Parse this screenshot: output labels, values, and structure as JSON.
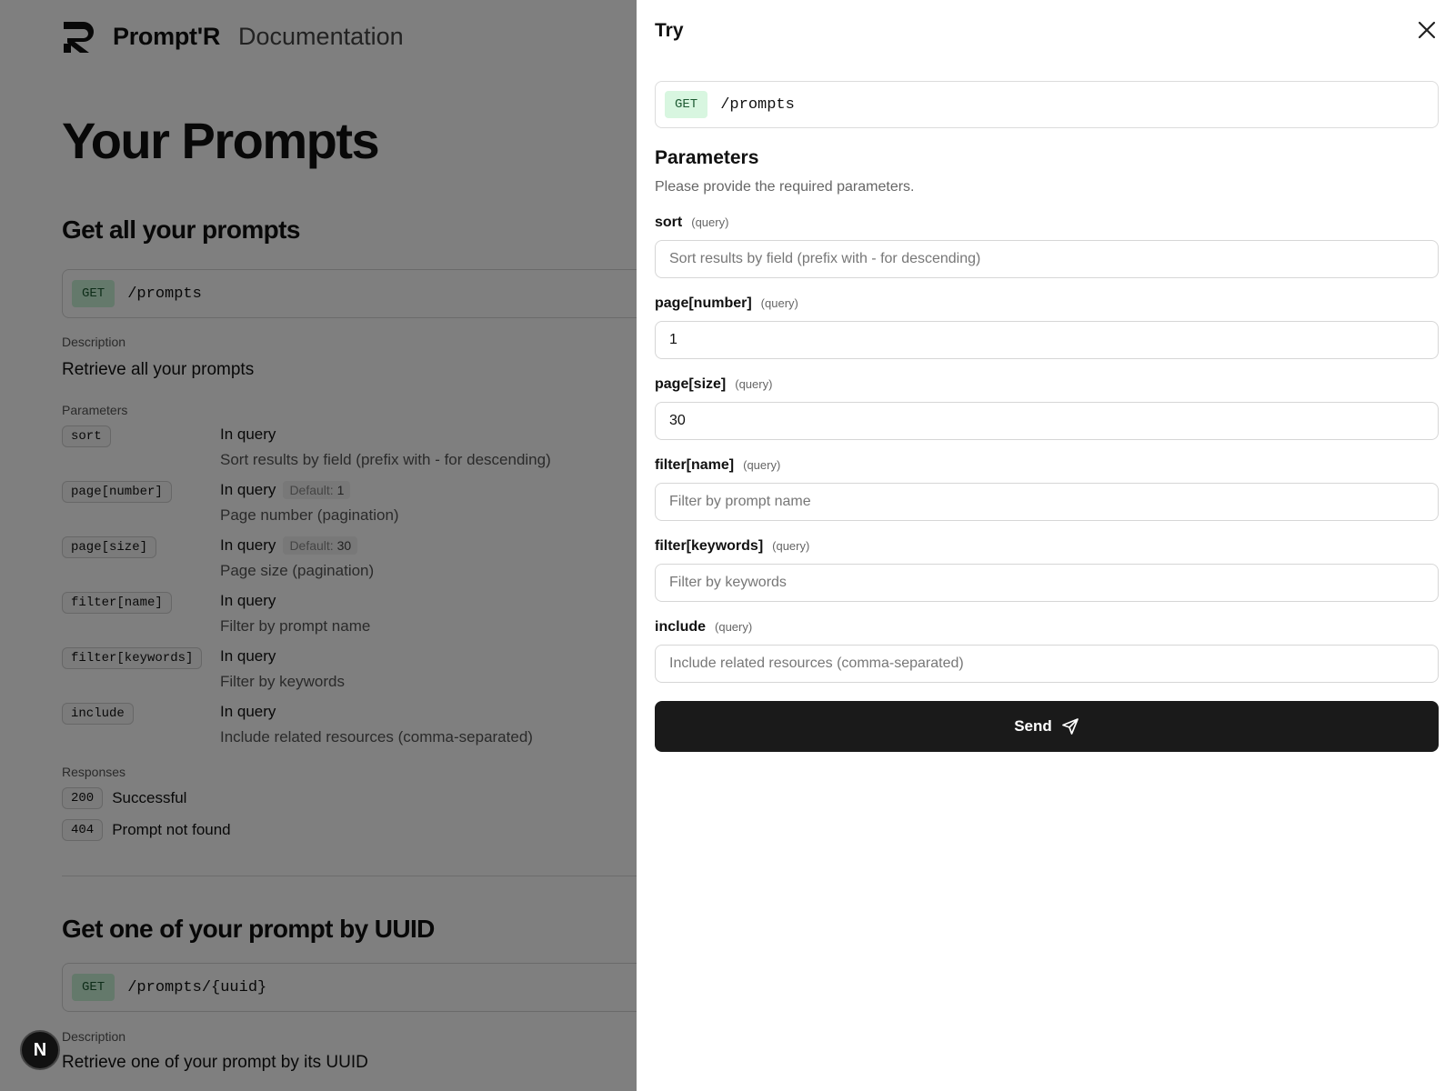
{
  "header": {
    "brand": "Prompt'R",
    "subtitle": "Documentation"
  },
  "page": {
    "title": "Your Prompts"
  },
  "section1": {
    "title": "Get all your prompts",
    "method": "GET",
    "path": "/prompts",
    "description_label": "Description",
    "description": "Retrieve all your prompts",
    "parameters_label": "Parameters",
    "params": [
      {
        "name": "sort",
        "in": "In query",
        "default_label": "",
        "default_value": "",
        "description": "Sort results by field (prefix with - for descending)"
      },
      {
        "name": "page[number]",
        "in": "In query",
        "default_label": "Default:",
        "default_value": "1",
        "description": "Page number (pagination)"
      },
      {
        "name": "page[size]",
        "in": "In query",
        "default_label": "Default:",
        "default_value": "30",
        "description": "Page size (pagination)"
      },
      {
        "name": "filter[name]",
        "in": "In query",
        "default_label": "",
        "default_value": "",
        "description": "Filter by prompt name"
      },
      {
        "name": "filter[keywords]",
        "in": "In query",
        "default_label": "",
        "default_value": "",
        "description": "Filter by keywords"
      },
      {
        "name": "include",
        "in": "In query",
        "default_label": "",
        "default_value": "",
        "description": "Include related resources (comma-separated)"
      }
    ],
    "responses_label": "Responses",
    "responses": [
      {
        "code": "200",
        "text": "Successful"
      },
      {
        "code": "404",
        "text": "Prompt not found"
      }
    ]
  },
  "section2": {
    "title": "Get one of your prompt by UUID",
    "method": "GET",
    "path": "/prompts/{uuid}",
    "description_label": "Description",
    "description": "Retrieve one of your prompt by its UUID"
  },
  "badge": {
    "letter": "N"
  },
  "drawer": {
    "title": "Try",
    "method": "GET",
    "path": "/prompts",
    "params_title": "Parameters",
    "params_subtitle": "Please provide the required parameters.",
    "fields": [
      {
        "label": "sort",
        "location": "(query)",
        "value": "",
        "placeholder": "Sort results by field (prefix with - for descending)"
      },
      {
        "label": "page[number]",
        "location": "(query)",
        "value": "1",
        "placeholder": ""
      },
      {
        "label": "page[size]",
        "location": "(query)",
        "value": "30",
        "placeholder": ""
      },
      {
        "label": "filter[name]",
        "location": "(query)",
        "value": "",
        "placeholder": "Filter by prompt name"
      },
      {
        "label": "filter[keywords]",
        "location": "(query)",
        "value": "",
        "placeholder": "Filter by keywords"
      },
      {
        "label": "include",
        "location": "(query)",
        "value": "",
        "placeholder": "Include related resources (comma-separated)"
      }
    ],
    "send_label": "Send"
  },
  "icons": {
    "logo": "promptr-logo-icon",
    "close": "close-icon",
    "send": "send-icon"
  }
}
